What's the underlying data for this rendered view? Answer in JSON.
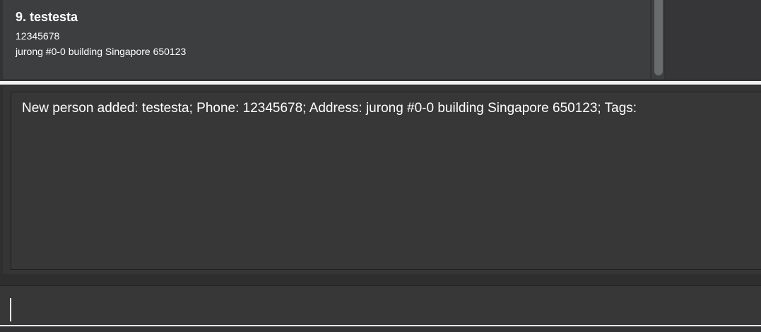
{
  "person_list": {
    "items": [
      {
        "index": "9. ",
        "name": "testesta",
        "phone": "12345678",
        "address": "jurong #0-0 building Singapore 650123"
      }
    ]
  },
  "result_display": {
    "text": "New person added: testesta; Phone: 12345678; Address: jurong #0-0 building Singapore 650123; Tags:"
  },
  "command_box": {
    "value": "",
    "placeholder": ""
  },
  "colors": {
    "background": "#2f2f30",
    "card": "#3c3e3f",
    "text": "#ffffff",
    "splitter": "#f2f2f2"
  }
}
